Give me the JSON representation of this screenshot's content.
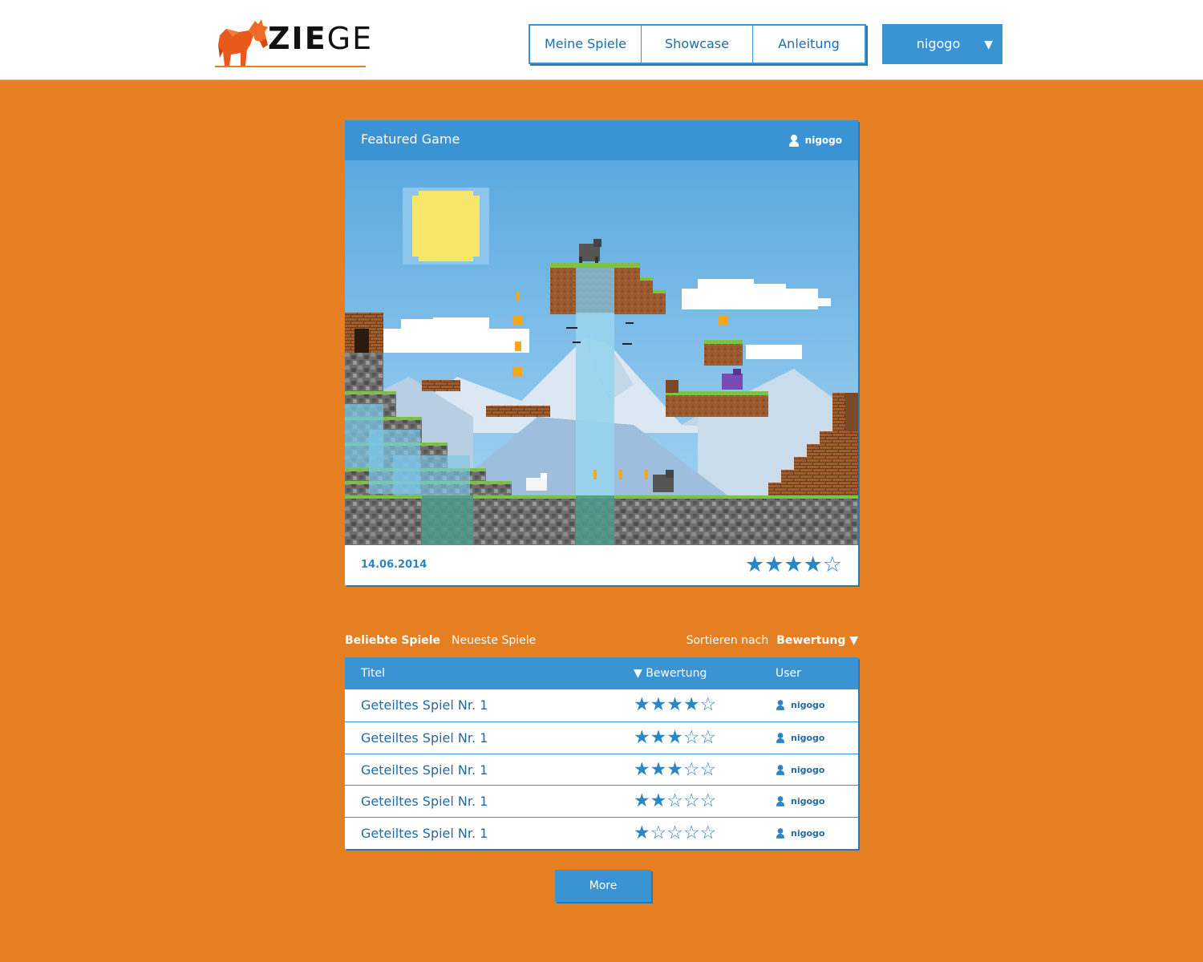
{
  "header": {
    "logo_text_bold": "ZIE",
    "logo_text_light": "GE",
    "nav": [
      {
        "label": "Meine Spiele"
      },
      {
        "label": "Showcase"
      },
      {
        "label": "Anleitung"
      }
    ],
    "user_menu": {
      "username": "nigogo",
      "caret": "▼"
    }
  },
  "featured": {
    "title": "Featured Game",
    "author": "nigogo",
    "date": "14.06.2014",
    "rating": 4,
    "rating_max": 5,
    "stars_text": "★★★★☆"
  },
  "list": {
    "tabs": [
      {
        "label": "Beliebte Spiele",
        "active": true
      },
      {
        "label": "Neueste Spiele",
        "active": false
      }
    ],
    "sort_label": "Sortieren nach",
    "sort_value": "Bewertung ▼",
    "columns": {
      "title": "Titel",
      "rating": "▼ Bewertung",
      "user": "User"
    },
    "rows": [
      {
        "title": "Geteiltes Spiel Nr. 1",
        "rating": 4,
        "stars": "★★★★☆",
        "user": "nigogo"
      },
      {
        "title": "Geteiltes Spiel Nr. 1",
        "rating": 3,
        "stars": "★★★☆☆",
        "user": "nigogo"
      },
      {
        "title": "Geteiltes Spiel Nr. 1",
        "rating": 3,
        "stars": "★★★☆☆",
        "user": "nigogo"
      },
      {
        "title": "Geteiltes Spiel Nr. 1",
        "rating": 2,
        "stars": "★★☆☆☆",
        "user": "nigogo"
      },
      {
        "title": "Geteiltes Spiel Nr. 1",
        "rating": 1,
        "stars": "★☆☆☆☆",
        "user": "nigogo"
      }
    ],
    "more_label": "More"
  },
  "colors": {
    "background": "#e67e22",
    "accent": "#3a93d3",
    "accent_dark": "#2b78b0",
    "sky": "#6fb5e6",
    "sun": "#f8e66a",
    "grass": "#7cc243",
    "dirt": "#9b5a2e",
    "stone": "#6b6b6b",
    "water": "#7cc6e6"
  }
}
